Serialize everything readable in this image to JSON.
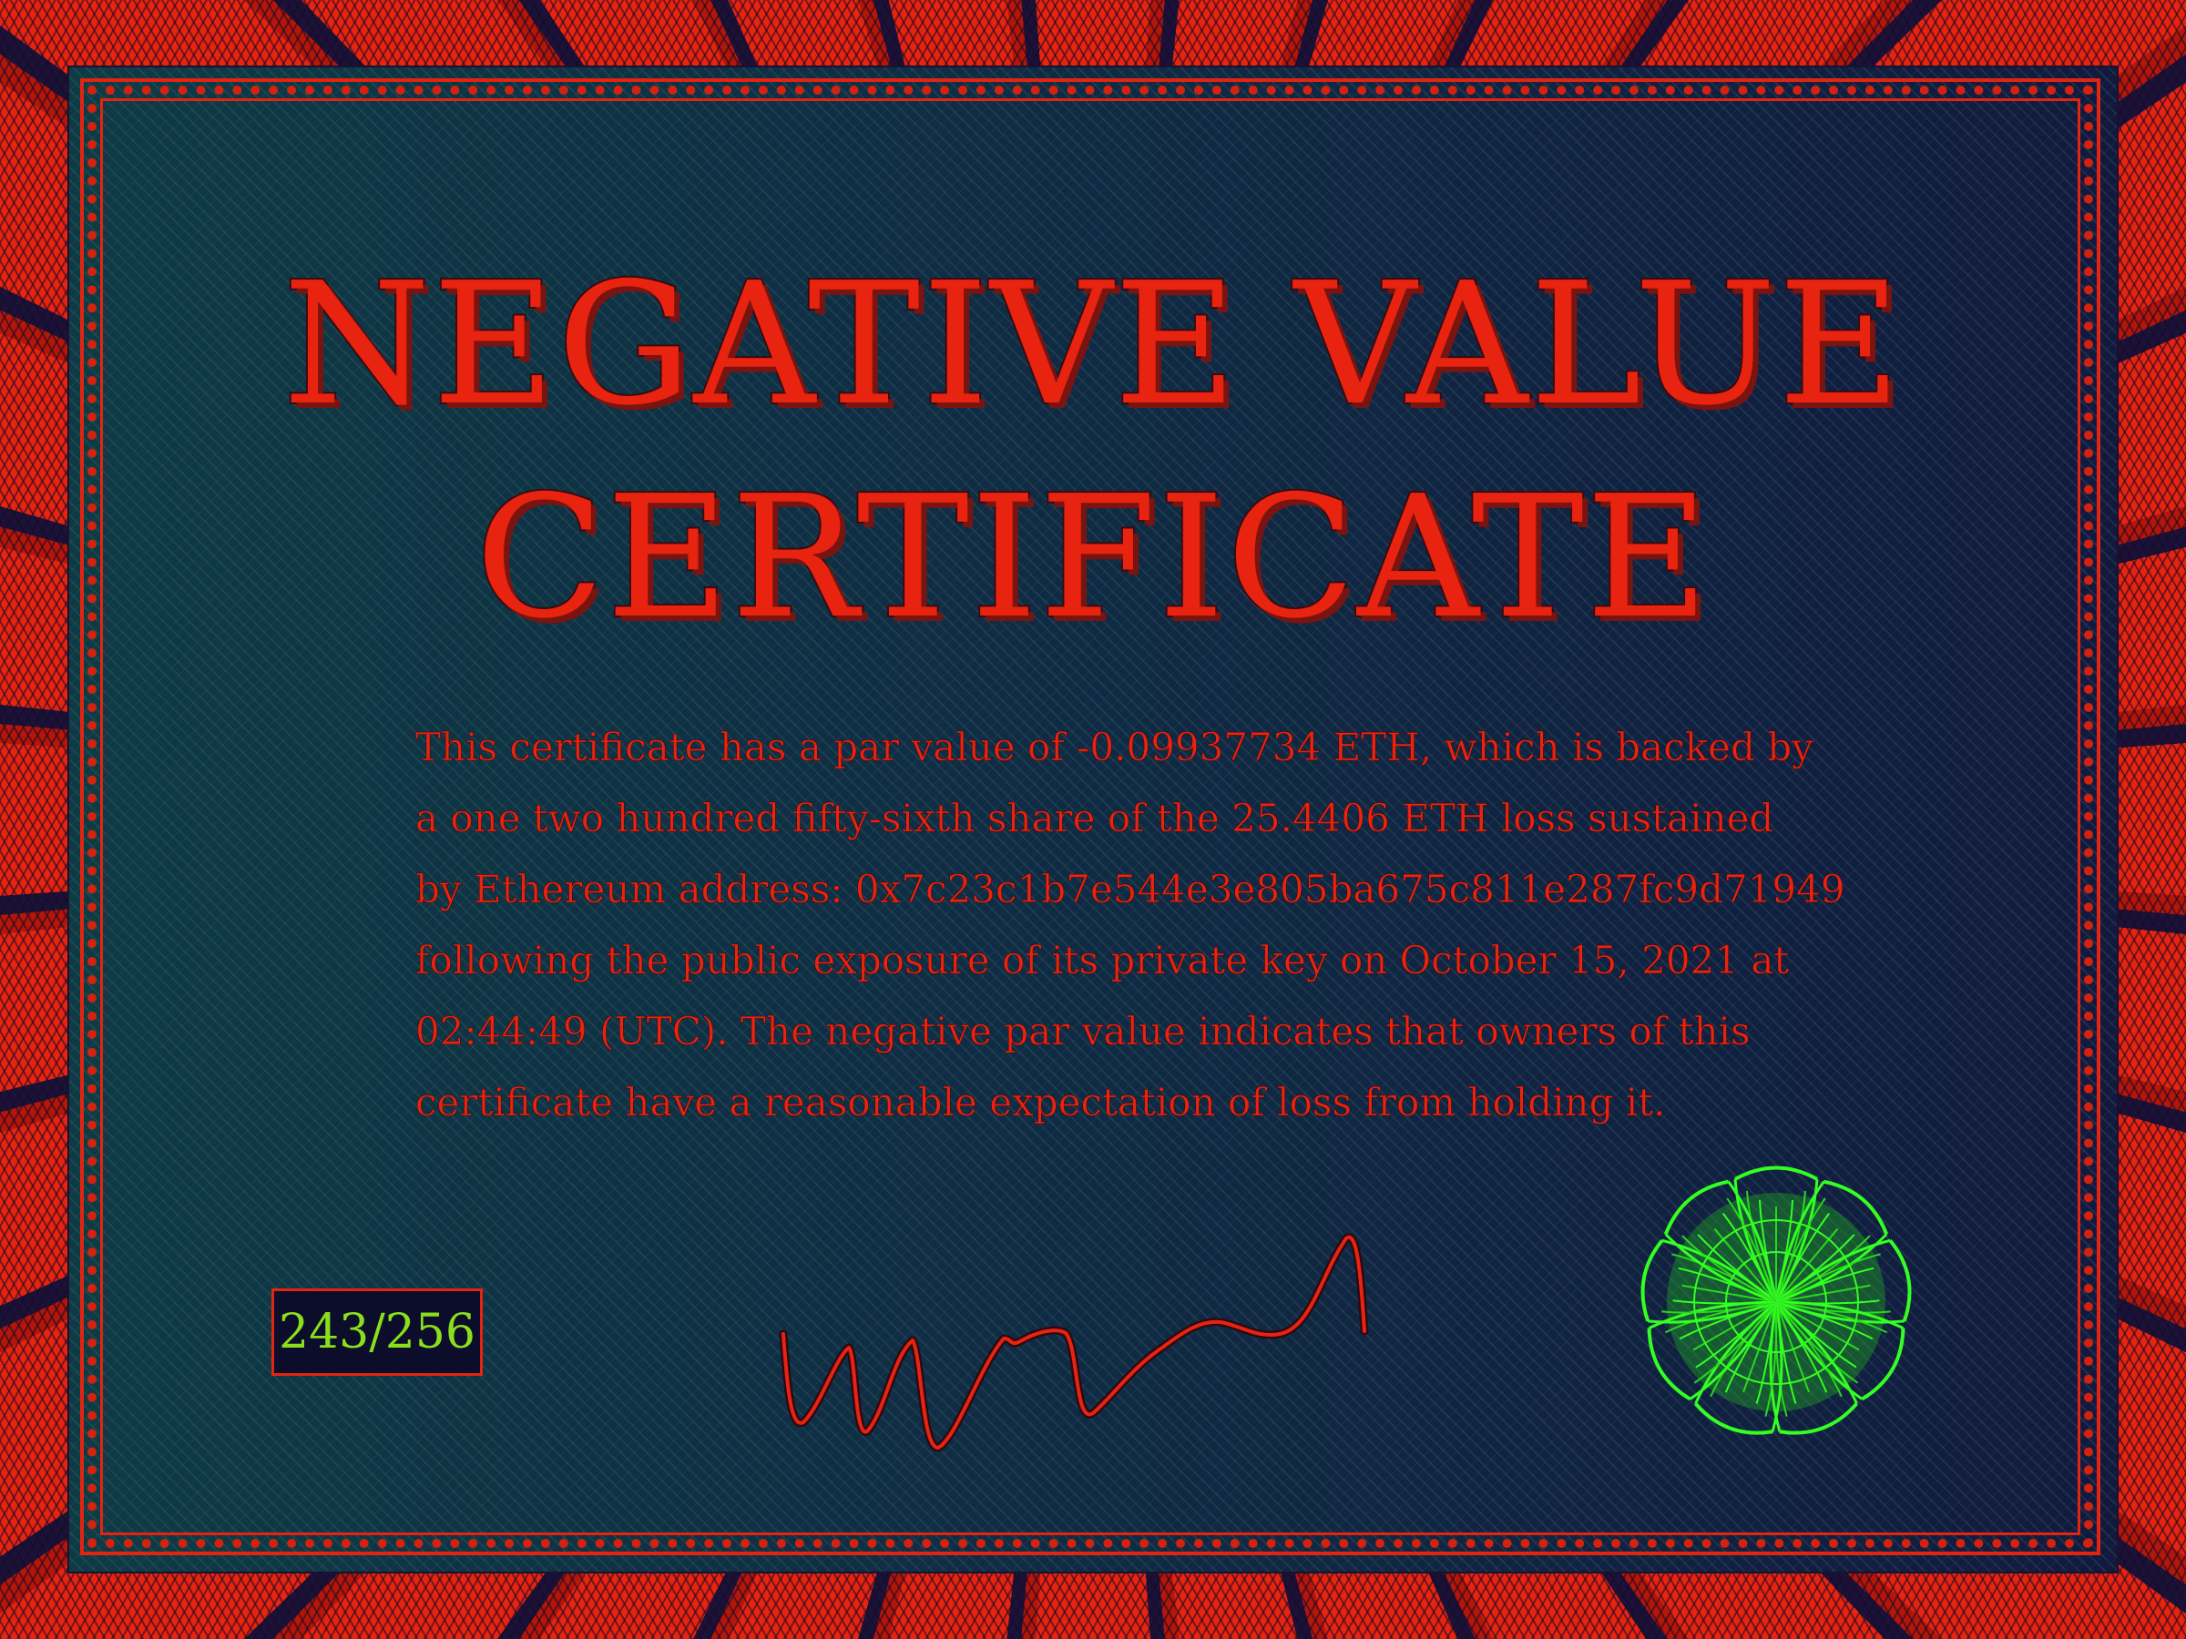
{
  "certificate": {
    "title_line1": "NEGATIVE VALUE",
    "title_line2": "CERTIFICATE",
    "body_lines": [
      "This certificate has a par value of -0.09937734 ETH, which is backed by",
      "a  one two hundred fifty-sixth  share of the 25.4406 ETH loss sustained",
      "by Ethereum address:   0x7c23c1b7e544e3e805ba675c811e287fc9d71949",
      "following the public exposure of its private key on  October 15, 2021  at",
      "02:44:49 (UTC).  The negative  par value  indicates that owners  of  this",
      "certificate have a reasonable expectation of loss from holding it."
    ],
    "serial": "243/256"
  },
  "colors": {
    "accent_red": "#e8230f",
    "panel_dark": "#0f2c44",
    "serial_green": "#8adf1c",
    "seal_green": "#33ff22"
  },
  "icons": {
    "signature": "handwritten-signature",
    "seal": "green-guilloche-seal"
  }
}
